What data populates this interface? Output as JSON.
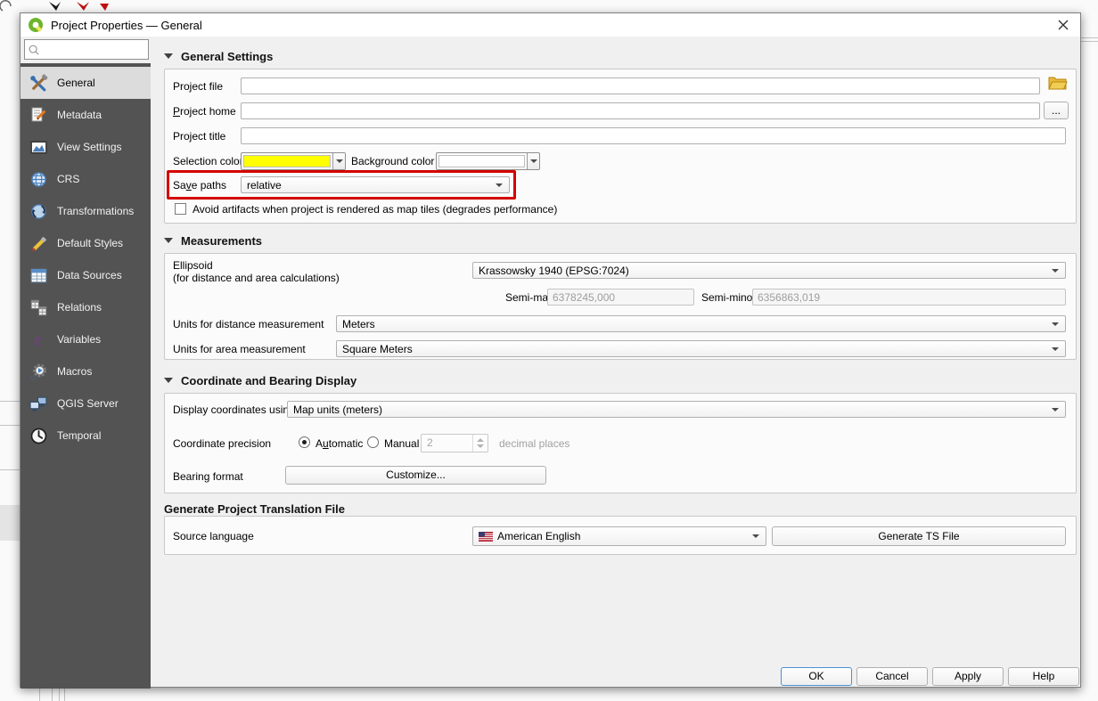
{
  "window": {
    "title": "Project Properties — General"
  },
  "sidebar": {
    "search": {
      "placeholder": ""
    },
    "selected": "General",
    "items": [
      {
        "label": "General"
      },
      {
        "label": "Metadata"
      },
      {
        "label": "View Settings"
      },
      {
        "label": "CRS"
      },
      {
        "label": "Transformations"
      },
      {
        "label": "Default Styles"
      },
      {
        "label": "Data Sources"
      },
      {
        "label": "Relations"
      },
      {
        "label": "Variables"
      },
      {
        "label": "Macros"
      },
      {
        "label": "QGIS Server"
      },
      {
        "label": "Temporal"
      }
    ]
  },
  "general": {
    "header": "General Settings",
    "project_file": {
      "label": "Project file",
      "value": ""
    },
    "project_home": {
      "label_u": "P",
      "label_rest": "roject home",
      "value": "",
      "browse": "..."
    },
    "project_title": {
      "label": "Project title",
      "value": ""
    },
    "selection_color": {
      "label": "Selection color",
      "color": "#ffff00"
    },
    "background_color": {
      "label_pre": "Back",
      "label_u": "g",
      "label_rest": "round color",
      "color": "#ffffff"
    },
    "save_paths": {
      "label_pre": "Sa",
      "label_u": "v",
      "label_rest": "e paths",
      "value": "relative"
    },
    "avoid_artifacts": {
      "label": "Avoid artifacts when project is rendered as map tiles (degrades performance)",
      "checked": false
    }
  },
  "measurements": {
    "header": "Measurements",
    "ellipsoid": {
      "label1": "Ellipsoid",
      "label2": "(for distance and area calculations)",
      "value": "Krassowsky 1940 (EPSG:7024)"
    },
    "semi_major": {
      "label": "Semi-major",
      "value": "6378245,000"
    },
    "semi_minor": {
      "label": "Semi-minor",
      "value": "6356863,019"
    },
    "distance_units": {
      "label": "Units for distance measurement",
      "value": "Meters"
    },
    "area_units": {
      "label": "Units for area measurement",
      "value": "Square Meters"
    }
  },
  "coordinates": {
    "header": "Coordinate and Bearing Display",
    "display_coords": {
      "label": "Display coordinates using",
      "value": "Map units (meters)"
    },
    "precision": {
      "label": "Coordinate precision",
      "automatic_pre": "A",
      "automatic_u": "u",
      "automatic_rest": "tomatic",
      "manual": "Manual",
      "selected": "Automatic",
      "decimal_value": "2",
      "decimal_suffix": "decimal places"
    },
    "bearing": {
      "label": "Bearing format",
      "button": "Customize..."
    }
  },
  "translation": {
    "header": "Generate Project Translation File",
    "source_language": {
      "label": "Source language",
      "value": "American English"
    },
    "generate_button": "Generate TS File"
  },
  "footer": {
    "ok": "OK",
    "cancel": "Cancel",
    "apply": "Apply",
    "help": "Help"
  },
  "colors": {
    "selection": "#ffff00",
    "background": "#ffffff",
    "highlight": "#d40000",
    "sidebar": "#535353"
  }
}
